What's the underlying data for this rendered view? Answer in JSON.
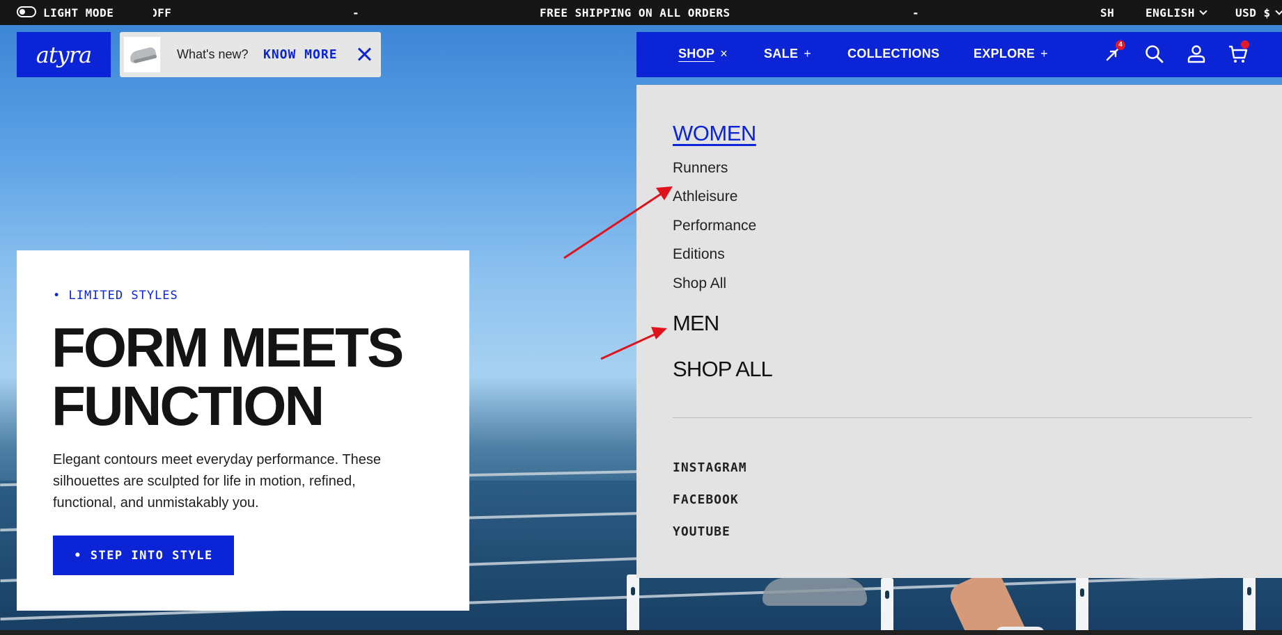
{
  "announcement": {
    "theme_toggle_label": "LIGHT MODE",
    "ticker_fragment_left": "OFF",
    "separator_left": "-",
    "message": "FREE SHIPPING ON ALL ORDERS",
    "separator_right": "-",
    "ticker_fragment_right": "SH",
    "language": "ENGLISH",
    "currency": "USD $"
  },
  "brand": {
    "logo_text": "atyra"
  },
  "whats_new": {
    "text": "What's new?",
    "link": "KNOW MORE"
  },
  "nav": {
    "items": [
      {
        "label": "SHOP",
        "symbol": "×"
      },
      {
        "label": "SALE",
        "symbol": "+"
      },
      {
        "label": "COLLECTIONS",
        "symbol": ""
      },
      {
        "label": "EXPLORE",
        "symbol": "+"
      }
    ],
    "compare_count": "4"
  },
  "dropdown": {
    "women_label": "WOMEN",
    "women_links": [
      "Runners",
      "Athleisure",
      "Performance",
      "Editions",
      "Shop All"
    ],
    "men_label": "MEN",
    "shop_all_label": "SHOP ALL",
    "social": [
      "INSTAGRAM",
      "FACEBOOK",
      "YOUTUBE"
    ]
  },
  "hero": {
    "eyebrow": "• LIMITED STYLES",
    "headline_line1": "FORM MEETS",
    "headline_line2": "FUNCTION",
    "description": "Elegant contours meet everyday performance. These silhouettes are sculpted for life in motion, refined, functional, and unmistakably you.",
    "cta_label": "• STEP INTO STYLE"
  },
  "colors": {
    "brand_blue": "#0a24d6",
    "annotation_red": "#e0131c",
    "dropdown_bg": "#e3e3e3"
  }
}
